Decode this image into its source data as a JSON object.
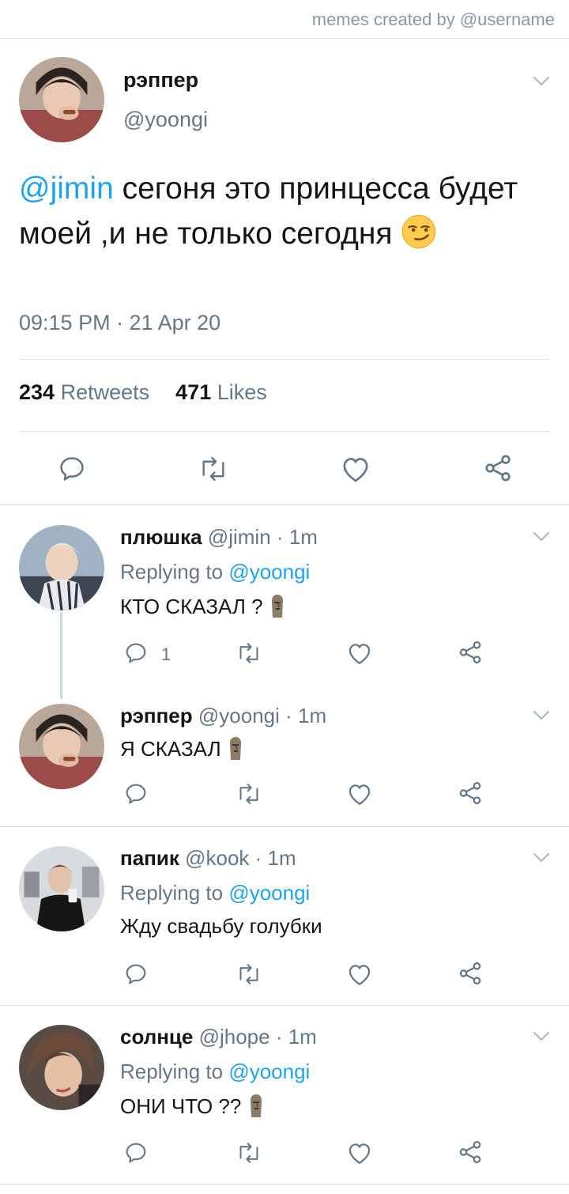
{
  "watermark": "memes created by @username",
  "main_tweet": {
    "display_name": "рэппер",
    "handle": "@yoongi",
    "mention": "@jimin",
    "text": " сегоня это принцесса будет моей ,и не только сегодня ",
    "emoji": "smirking-face",
    "timestamp": "09:15 PM · 21 Apr 20",
    "retweets_count": "234",
    "retweets_label": "Retweets",
    "likes_count": "471",
    "likes_label": "Likes"
  },
  "replies": [
    {
      "display_name": "плюшка",
      "handle": "@jimin",
      "time": "· 1m",
      "replying_label": "Replying to",
      "replying_to": "@yoongi",
      "text": "КТО СКАЗАЛ ?",
      "emoji": "moai",
      "reply_count": "1"
    },
    {
      "display_name": "рэппер",
      "handle": "@yoongi",
      "time": "· 1m",
      "text": "Я СКАЗАЛ",
      "emoji": "moai"
    },
    {
      "display_name": "папик",
      "handle": "@kook",
      "time": "· 1m",
      "replying_label": "Replying to",
      "replying_to": "@yoongi",
      "text": "Жду свадьбу голубки"
    },
    {
      "display_name": "солнце",
      "handle": "@jhope",
      "time": "· 1m",
      "replying_label": "Replying to",
      "replying_to": "@yoongi",
      "text": "ОНИ ЧТО ??",
      "emoji": "moai"
    }
  ],
  "colors": {
    "accent": "#1da1f2",
    "secondary_text": "#657786",
    "icon": "#657786",
    "divider": "#e1e8ed"
  }
}
